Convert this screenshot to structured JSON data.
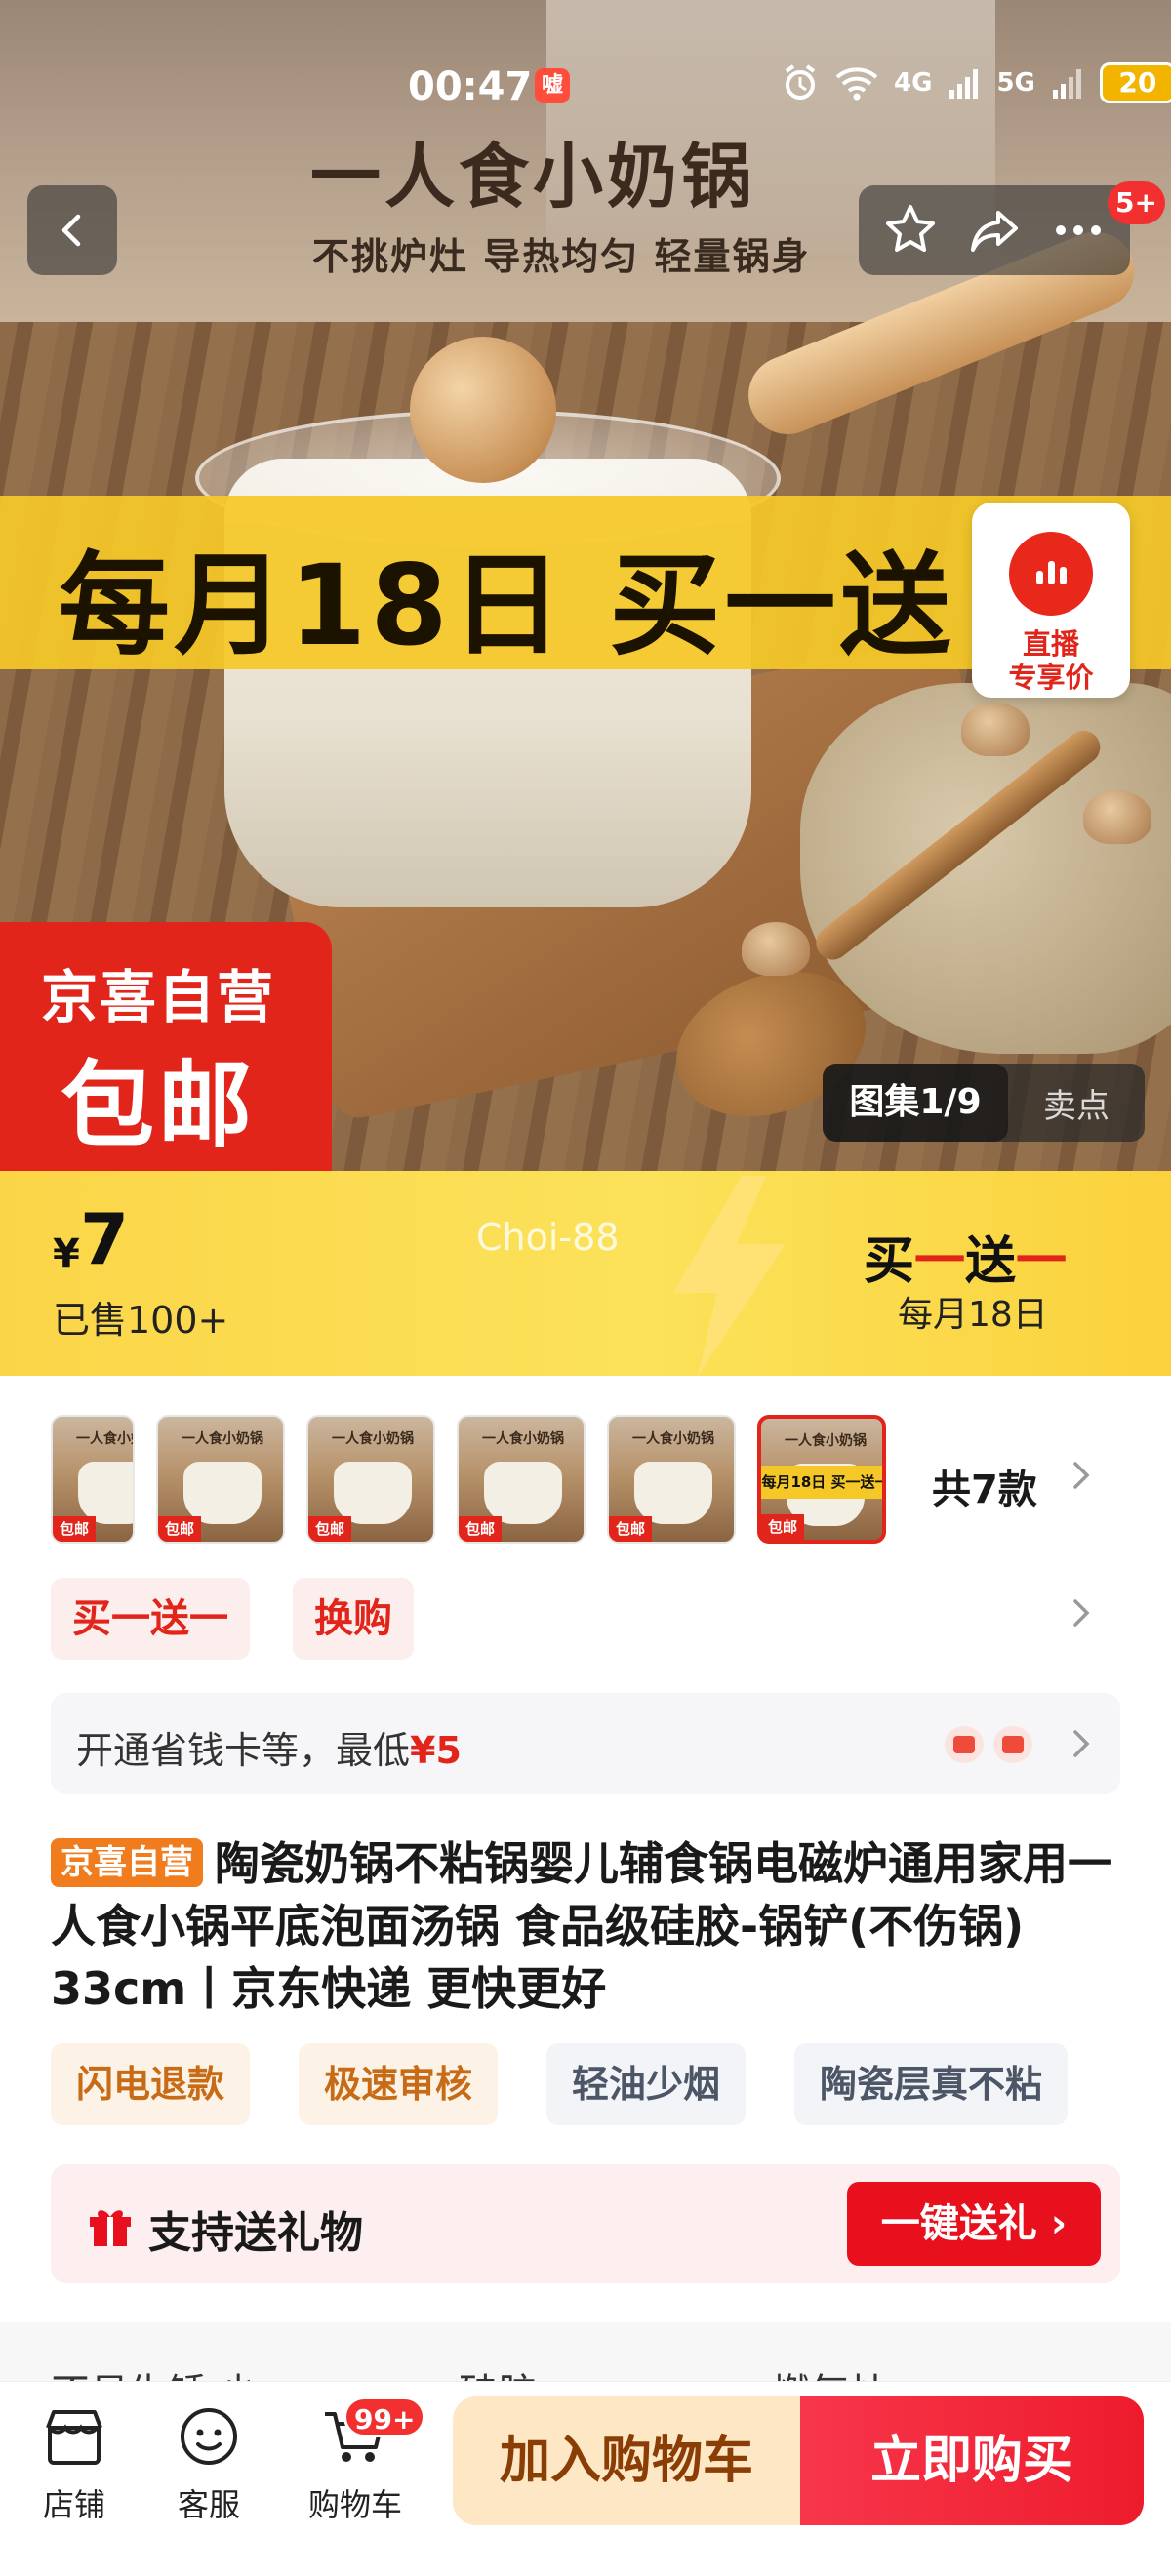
{
  "status_bar": {
    "time": "00:47",
    "app_badge": "嘘",
    "net1": "4G",
    "net2": "5G",
    "battery": "20"
  },
  "hero": {
    "title": "一人食小奶锅",
    "subtitle": "不挑炉灶  导热均匀  轻量锅身",
    "promo": "每月18日 买一送",
    "badge_line1": "京喜自营",
    "badge_line2": "包邮",
    "more_badge": "5+",
    "live_line1": "直播",
    "live_line2": "专享价",
    "gallery_label": "图集1/9",
    "selling_points": "卖点"
  },
  "price": {
    "currency": "¥",
    "value": "7",
    "sold": "已售100+",
    "watermark": "Choi-88",
    "promo_a": "买",
    "promo_b": "一",
    "promo_c": "送",
    "promo_d": "一",
    "promo_sub": "每月18日"
  },
  "variants": {
    "thumb_caption": "一人食小奶锅",
    "thumb_tag": "包邮",
    "thumb_band": "每月18日 买一送一",
    "count_label": "共7款"
  },
  "promo_tags": [
    "买一送一",
    "换购"
  ],
  "savings": {
    "text": "开通省钱卡等，最低",
    "price": "¥5"
  },
  "product": {
    "badge": "京喜自营",
    "title": "陶瓷奶锅不粘锅婴儿辅食锅电磁炉通用家用一人食小锅平底泡面汤锅 食品级硅胶-锅铲(不伤锅) 33cm丨京东快递 更快更好"
  },
  "features": [
    "闪电退款",
    "极速审核",
    "轻油少烟",
    "陶瓷层真不粘"
  ],
  "gift": {
    "label": "支持送礼物",
    "button": "一键送礼 ›"
  },
  "partial_row": [
    "不易生锈 少",
    "硅胶",
    "燃气灶"
  ],
  "bottom_nav": {
    "shop": "店铺",
    "service": "客服",
    "cart": "购物车",
    "cart_badge": "99+"
  },
  "actions": {
    "add_to_cart": "加入购物车",
    "buy_now": "立即购买"
  },
  "colors": {
    "accent_red": "#e1251b",
    "promo_yellow": "#fbd548",
    "buy_red": "#ed1c2c",
    "cart_bg": "#fde7c4"
  }
}
